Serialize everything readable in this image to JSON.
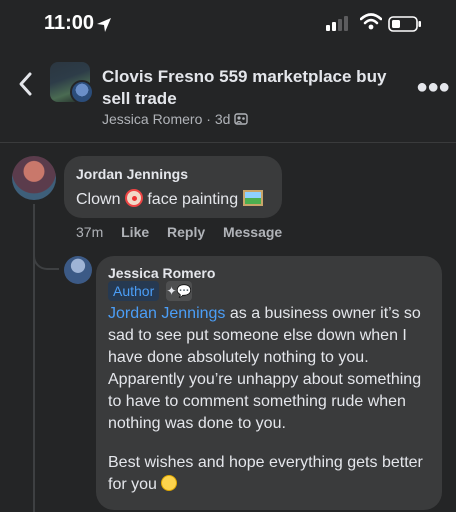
{
  "status_bar": {
    "time": "11:00"
  },
  "header": {
    "group_title": "Clovis Fresno 559 marketplace buy sell trade",
    "author": "Jessica Romero",
    "separator": " · ",
    "age": "3d"
  },
  "comments": [
    {
      "author": "Jordan Jennings",
      "text_before": "Clown ",
      "text_middle": " face painting ",
      "time": "37m",
      "actions": [
        "Like",
        "Reply",
        "Message"
      ]
    },
    {
      "author": "Jessica Romero",
      "badge": "Author",
      "mention": "Jordan Jennings",
      "text": " as a business owner it’s so sad to see put someone else down when I have done absolutely nothing to you. Apparently you’re unhappy about something to have to comment something rude when nothing was done to you.",
      "text2": "Best wishes and hope everything gets better for you "
    }
  ],
  "colors": {
    "background": "#242526",
    "bubble": "#3a3b3c",
    "link": "#4b9ef7",
    "badge_bg": "#263951"
  }
}
